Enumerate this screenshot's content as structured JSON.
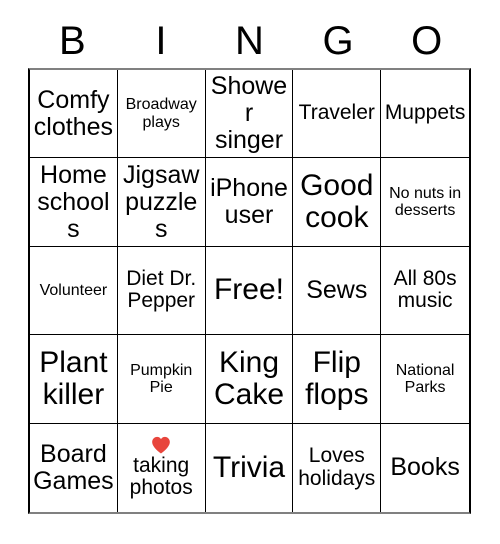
{
  "card": {
    "title": "BINGO",
    "header_letters": [
      "B",
      "I",
      "N",
      "G",
      "O"
    ],
    "free_space_label": "Free!",
    "colors": {
      "grid_line": "#000000",
      "outer_line": "#808080",
      "text": "#000000",
      "background": "#ffffff",
      "heart": "#e8453c"
    },
    "rows": [
      [
        {
          "text": "Comfy clothes",
          "size": "lg"
        },
        {
          "text": "Broadway plays",
          "size": "sm"
        },
        {
          "text": "Shower singer",
          "size": "lg"
        },
        {
          "text": "Traveler",
          "size": "md"
        },
        {
          "text": "Muppets",
          "size": "md"
        }
      ],
      [
        {
          "text": "Home schools",
          "size": "lg"
        },
        {
          "text": "Jigsaw puzzles",
          "size": "lg"
        },
        {
          "text": "iPhone user",
          "size": "lg"
        },
        {
          "text": "Good cook",
          "size": "xl"
        },
        {
          "text": "No nuts in desserts",
          "size": "sm"
        }
      ],
      [
        {
          "text": "Volunteer",
          "size": "sm"
        },
        {
          "text": "Diet Dr. Pepper",
          "size": "md"
        },
        {
          "text": "Free!",
          "size": "xl",
          "free": true
        },
        {
          "text": "Sews",
          "size": "lg"
        },
        {
          "text": "All 80s music",
          "size": "md"
        }
      ],
      [
        {
          "text": "Plant killer",
          "size": "xl"
        },
        {
          "text": "Pumpkin Pie",
          "size": "sm"
        },
        {
          "text": "King Cake",
          "size": "xl"
        },
        {
          "text": "Flip flops",
          "size": "xl"
        },
        {
          "text": "National Parks",
          "size": "sm"
        }
      ],
      [
        {
          "text": "Board Games",
          "size": "lg"
        },
        {
          "text": "taking photos",
          "size": "md",
          "emoji": "heart-emoji"
        },
        {
          "text": "Trivia",
          "size": "xl"
        },
        {
          "text": "Loves holidays",
          "size": "md"
        },
        {
          "text": "Books",
          "size": "lg"
        }
      ]
    ]
  }
}
